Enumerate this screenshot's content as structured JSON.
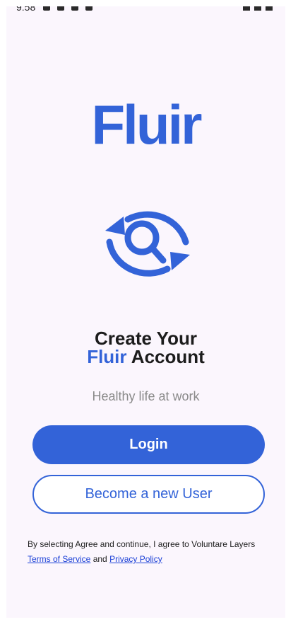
{
  "status_bar": {
    "time": "9:58"
  },
  "logo": {
    "text": "Fluir"
  },
  "hero": {
    "icon": "refresh-search-icon"
  },
  "title": {
    "line1": "Create Your",
    "accent": "Fluir",
    "line2_rest": " Account"
  },
  "tagline": "Healthy life at work",
  "buttons": {
    "login": "Login",
    "new_user": "Become a new User"
  },
  "legal": {
    "text": "By selecting Agree and continue, I agree to Voluntare Layers",
    "terms": "Terms of Service",
    "and": " and ",
    "privacy": "Privacy Policy"
  },
  "colors": {
    "brand": "#3363d8",
    "background": "#fbf6fd",
    "link": "#1a3fd6"
  }
}
